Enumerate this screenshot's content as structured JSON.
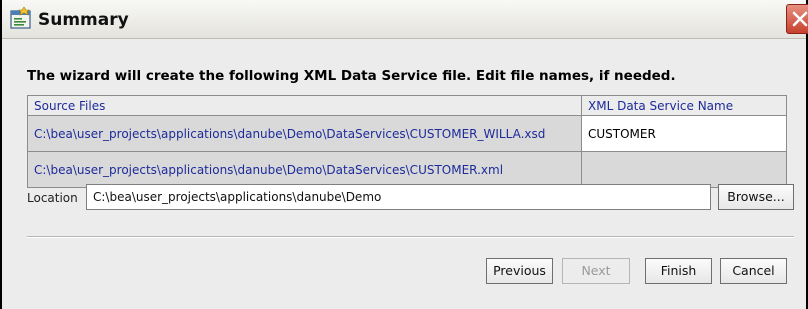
{
  "window": {
    "title": "Summary"
  },
  "heading": "The wizard will create the following XML Data Service file.  Edit file names, if needed.",
  "table": {
    "columns": [
      "Source Files",
      "XML Data Service Name"
    ],
    "rows": [
      {
        "source": "C:\\bea\\user_projects\\applications\\danube\\Demo\\DataServices\\CUSTOMER_WILLA.xsd",
        "name": "CUSTOMER"
      },
      {
        "source": "C:\\bea\\user_projects\\applications\\danube\\Demo\\DataServices\\CUSTOMER.xml",
        "name": ""
      }
    ]
  },
  "location": {
    "label": "Location",
    "value": "C:\\bea\\user_projects\\applications\\danube\\Demo",
    "browse_label": "Browse..."
  },
  "buttons": {
    "previous": "Previous",
    "next": "Next",
    "finish": "Finish",
    "cancel": "Cancel"
  },
  "colors": {
    "link_text": "#1d2b9a",
    "close_button": "#c6412c"
  }
}
